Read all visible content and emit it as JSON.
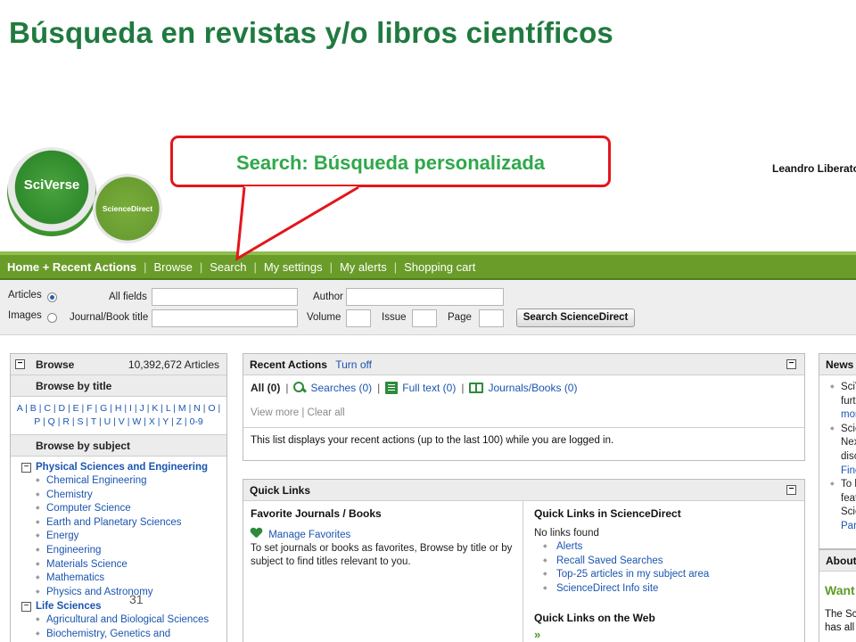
{
  "slide": {
    "title": "Búsqueda en revistas y/o libros científicos",
    "page_number": "31"
  },
  "logos": {
    "sciverse": "SciVerse",
    "sciencedirect": "ScienceDirect"
  },
  "user": {
    "name": "Leandro Liberator"
  },
  "callout": {
    "text": "Search: Búsqueda personalizada",
    "border_color": "#e3161b",
    "text_color": "#2fa84a"
  },
  "nav": {
    "items": [
      {
        "label": "Home + Recent Actions",
        "active": true
      },
      {
        "label": "Browse"
      },
      {
        "label": "Search"
      },
      {
        "label": "My settings"
      },
      {
        "label": "My alerts"
      },
      {
        "label": "Shopping cart"
      }
    ],
    "bg_color": "#6a9c2a"
  },
  "search": {
    "articles_label": "Articles",
    "images_label": "Images",
    "selected": "Articles",
    "all_fields_label": "All fields",
    "journal_label": "Journal/Book title",
    "author_label": "Author",
    "volume_label": "Volume",
    "issue_label": "Issue",
    "page_label": "Page",
    "all_fields_value": "",
    "journal_value": "",
    "author_value": "",
    "volume_value": "",
    "issue_value": "",
    "page_value": "",
    "button_label": "Search ScienceDirect"
  },
  "browse": {
    "title": "Browse",
    "count": "10,392,672 Articles",
    "by_title_label": "Browse by title",
    "alphabet_row1": "A | B | C | D | E | F | G | H | I | J | K | L | M | N | O |",
    "alphabet_row2": "P | Q | R | S | T | U | V | W | X | Y | Z | 0-9",
    "by_subject_label": "Browse by subject",
    "categories": [
      {
        "label": "Physical Sciences and Engineering",
        "items": [
          "Chemical Engineering",
          "Chemistry",
          "Computer Science",
          "Earth and Planetary Sciences",
          "Energy",
          "Engineering",
          "Materials Science",
          "Mathematics",
          "Physics and Astronomy"
        ]
      },
      {
        "label": "Life Sciences",
        "items": [
          "Agricultural and Biological Sciences",
          "Biochemistry, Genetics and"
        ]
      }
    ]
  },
  "recent": {
    "title": "Recent Actions",
    "turn_off": "Turn off",
    "all": "All (0)",
    "searches": "Searches (0)",
    "fulltext": "Full text (0)",
    "journals": "Journals/Books (0)",
    "view_more": "View more",
    "clear_all": "Clear all",
    "info": "This list displays your recent actions (up to the last 100) while you are logged in."
  },
  "quick": {
    "title": "Quick Links",
    "fav_title": "Favorite Journals / Books",
    "manage": "Manage Favorites",
    "fav_text": "To set journals or books as favorites, Browse by title or by subject to find titles relevant to you.",
    "sd_title": "Quick Links in ScienceDirect",
    "no_links": "No links found",
    "sd_links": [
      "Alerts",
      "Recall Saved Searches",
      "Top-25 articles in my subject area",
      "ScienceDirect Info site"
    ],
    "web_title": "Quick Links on the Web",
    "web_arrow": "»"
  },
  "news": {
    "title": "News",
    "lines": [
      "SciV",
      "furth",
      "more",
      "Scie",
      "Nex",
      "disc",
      "Find",
      "To h",
      "feat",
      "Scie",
      "Par"
    ]
  },
  "about": {
    "title": "About",
    "want": "Want",
    "line1": "The Sci",
    "line2": "has all"
  }
}
